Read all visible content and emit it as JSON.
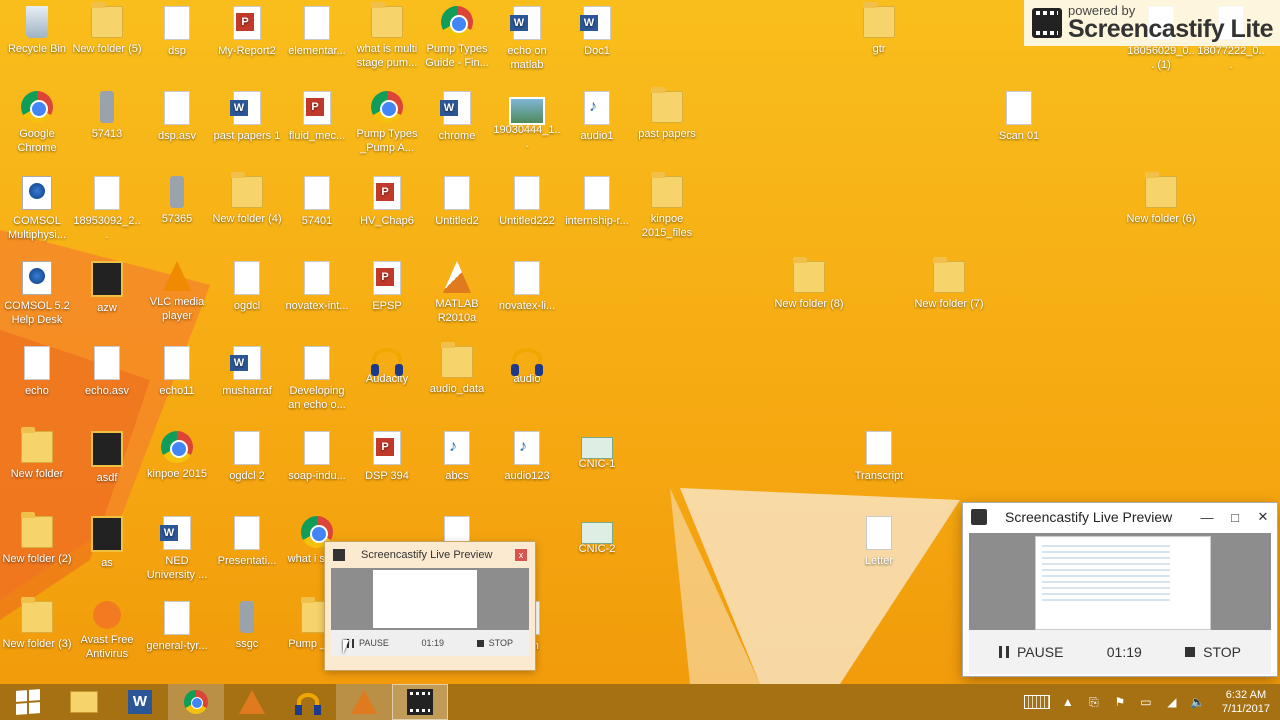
{
  "desktop_icons": [
    {
      "label": "Recycle Bin",
      "icon": "recycle-bin-icon"
    },
    {
      "label": "New folder (5)",
      "icon": "folder-icon"
    },
    {
      "label": "dsp",
      "icon": "matlab-file-icon"
    },
    {
      "label": "My-Report2",
      "icon": "pdf-icon"
    },
    {
      "label": "elementar...",
      "icon": "document-icon"
    },
    {
      "label": "what is multi stage pum...",
      "icon": "folder-icon"
    },
    {
      "label": "Pump Types Guide - Fin...",
      "icon": "chrome-icon"
    },
    {
      "label": "echo on matlab",
      "icon": "word-icon"
    },
    {
      "label": "Doc1",
      "icon": "word-icon"
    },
    {
      "label": "gtr",
      "icon": "folder-icon"
    },
    {
      "label": "Google Chrome",
      "icon": "chrome-icon"
    },
    {
      "label": "57413",
      "icon": "phone-icon"
    },
    {
      "label": "dsp.asv",
      "icon": "document-icon"
    },
    {
      "label": "past papers 1",
      "icon": "word-icon"
    },
    {
      "label": "fluid_mec...",
      "icon": "pdf-icon"
    },
    {
      "label": "Pump Types _Pump A...",
      "icon": "chrome-icon"
    },
    {
      "label": "chrome",
      "icon": "word-icon"
    },
    {
      "label": "19030444_1...",
      "icon": "image-icon"
    },
    {
      "label": "audio1",
      "icon": "wav-icon"
    },
    {
      "label": "past papers",
      "icon": "folder-icon"
    },
    {
      "label": "Scan 01",
      "icon": "document-icon"
    },
    {
      "label": "COMSOL Multiphysi...",
      "icon": "comsol-icon"
    },
    {
      "label": "18953092_2...",
      "icon": "document-icon"
    },
    {
      "label": "57365",
      "icon": "phone-icon"
    },
    {
      "label": "New folder (4)",
      "icon": "folder-icon"
    },
    {
      "label": "57401",
      "icon": "document-icon"
    },
    {
      "label": "HV_Chap6",
      "icon": "pdf-icon"
    },
    {
      "label": "Untitled2",
      "icon": "matlab-file-icon"
    },
    {
      "label": "Untitled222",
      "icon": "matlab-file-icon"
    },
    {
      "label": "internship-r...",
      "icon": "document-icon"
    },
    {
      "label": "kinpoe 2015_files",
      "icon": "folder-icon"
    },
    {
      "label": "New folder (6)",
      "icon": "folder-icon"
    },
    {
      "label": "COMSOL 5.2 Help Desk",
      "icon": "comsol-icon"
    },
    {
      "label": "azw",
      "icon": "film-icon"
    },
    {
      "label": "VLC media player",
      "icon": "vlc-icon"
    },
    {
      "label": "ogdcl",
      "icon": "document-icon"
    },
    {
      "label": "novatex-int...",
      "icon": "document-icon"
    },
    {
      "label": "EPSP",
      "icon": "pdf-icon"
    },
    {
      "label": "MATLAB R2010a",
      "icon": "matlab-icon"
    },
    {
      "label": "novatex-li...",
      "icon": "document-icon"
    },
    {
      "label": "New folder (8)",
      "icon": "folder-icon"
    },
    {
      "label": "New folder (7)",
      "icon": "folder-icon"
    },
    {
      "label": "echo",
      "icon": "matlab-file-icon"
    },
    {
      "label": "echo.asv",
      "icon": "document-icon"
    },
    {
      "label": "echo11",
      "icon": "matlab-file-icon"
    },
    {
      "label": "musharraf",
      "icon": "word-icon"
    },
    {
      "label": "Developing an echo o...",
      "icon": "document-icon"
    },
    {
      "label": "Audacity",
      "icon": "audacity-icon"
    },
    {
      "label": "audio_data",
      "icon": "folder-icon"
    },
    {
      "label": "audio",
      "icon": "audacity-icon"
    },
    {
      "label": "New folder",
      "icon": "folder-icon"
    },
    {
      "label": "asdf",
      "icon": "film-icon"
    },
    {
      "label": "kinpoe 2015",
      "icon": "chrome-icon"
    },
    {
      "label": "ogdcl 2",
      "icon": "document-icon"
    },
    {
      "label": "soap-indu...",
      "icon": "document-icon"
    },
    {
      "label": "DSP 394",
      "icon": "pdf-icon"
    },
    {
      "label": "abcs",
      "icon": "wma-icon"
    },
    {
      "label": "audio123",
      "icon": "wav-icon"
    },
    {
      "label": "CNIC-1",
      "icon": "card-icon"
    },
    {
      "label": "Transcript",
      "icon": "document-icon"
    },
    {
      "label": "New folder (2)",
      "icon": "folder-icon"
    },
    {
      "label": "as",
      "icon": "film-icon"
    },
    {
      "label": "NED University ...",
      "icon": "word-icon"
    },
    {
      "label": "Presentati...",
      "icon": "document-icon"
    },
    {
      "label": "what i stage",
      "icon": "chrome-icon"
    },
    {
      "label": ".asv",
      "icon": "document-icon"
    },
    {
      "label": "CNIC-2",
      "icon": "card-icon"
    },
    {
      "label": "Letter",
      "icon": "document-icon"
    },
    {
      "label": "New folder (3)",
      "icon": "folder-icon"
    },
    {
      "label": "Avast Free Antivirus",
      "icon": "avast-icon"
    },
    {
      "label": "general-tyr...",
      "icon": "document-icon"
    },
    {
      "label": "ssgc",
      "icon": "phone-icon"
    },
    {
      "label": "Pump _Pun",
      "icon": "folder-icon"
    },
    {
      "label": "ution",
      "icon": "document-icon"
    },
    {
      "label": "18056029_0... (1)",
      "icon": "document-icon"
    },
    {
      "label": "18077222_0...",
      "icon": "document-icon"
    }
  ],
  "watermark": {
    "small": "powered by",
    "big": "Screencastify Lite"
  },
  "preview_large": {
    "title": "Screencastify Live Preview",
    "minimize": "—",
    "maximize": "□",
    "close": "✕",
    "pause_label": "PAUSE",
    "timer": "01:19",
    "stop_label": "STOP"
  },
  "preview_small": {
    "title": "Screencastify Live Preview",
    "close": "x",
    "pause_label": "PAUSE",
    "timer": "01:19",
    "stop_label": "STOP"
  },
  "taskbar": {
    "apps": [
      "start",
      "file-explorer",
      "word",
      "chrome",
      "matlab",
      "audacity",
      "matlab-active",
      "screencastify"
    ],
    "clock_time": "6:32 AM",
    "clock_date": "7/11/2017",
    "tray_chevron": "▲"
  },
  "colors": {
    "desktop_bg": "#f7b21a",
    "taskbar_bg": "#a06e14",
    "accent": "#2b5797"
  }
}
